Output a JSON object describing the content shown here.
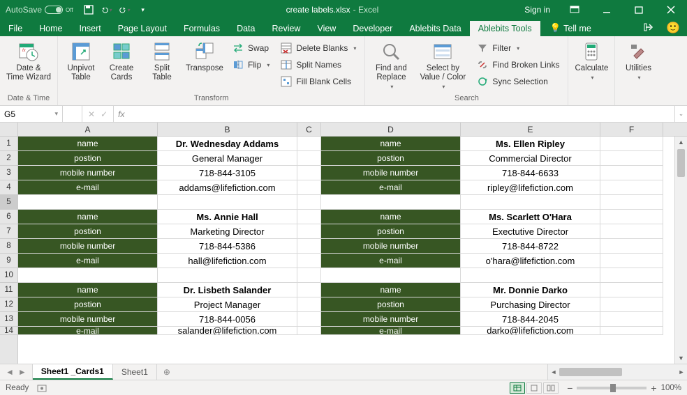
{
  "titlebar": {
    "autosave_label": "AutoSave",
    "autosave_state": "Off",
    "filename": "create labels.xlsx",
    "app_suffix": " -  Excel",
    "signin": "Sign in"
  },
  "tabs": {
    "file": "File",
    "home": "Home",
    "insert": "Insert",
    "page_layout": "Page Layout",
    "formulas": "Formulas",
    "data": "Data",
    "review": "Review",
    "view": "View",
    "developer": "Developer",
    "ablebits_data": "Ablebits Data",
    "ablebits_tools": "Ablebits Tools",
    "tell_me": "Tell me"
  },
  "ribbon": {
    "date_time": {
      "btn": "Date &\nTime Wizard",
      "group": "Date & Time"
    },
    "transform": {
      "unpivot": "Unpivot\nTable",
      "create_cards": "Create\nCards",
      "split_table": "Split\nTable",
      "transpose": "Transpose",
      "swap": "Swap",
      "flip": "Flip",
      "delete_blanks": "Delete Blanks",
      "split_names": "Split Names",
      "fill_blank": "Fill Blank Cells",
      "group": "Transform"
    },
    "search": {
      "find_replace": "Find and\nReplace",
      "select_value": "Select by\nValue / Color",
      "filter": "Filter",
      "broken_links": "Find Broken Links",
      "sync_sel": "Sync Selection",
      "group": "Search"
    },
    "calculate": {
      "btn": "Calculate",
      "group": ""
    },
    "utilities": {
      "btn": "Utilities",
      "group": ""
    }
  },
  "formula_bar": {
    "namebox": "G5",
    "formula": ""
  },
  "columns": [
    "A",
    "B",
    "C",
    "D",
    "E",
    "F"
  ],
  "row_numbers": [
    "1",
    "2",
    "3",
    "4",
    "5",
    "6",
    "7",
    "8",
    "9",
    "10",
    "11",
    "12",
    "13",
    "14"
  ],
  "labels": {
    "name": "name",
    "position": "postion",
    "mobile": "mobile number",
    "email": "e-mail"
  },
  "cards": [
    {
      "B": {
        "name": "Dr. Wednesday Addams",
        "position": "General Manager",
        "mobile": "718-844-3105",
        "email": "addams@lifefiction.com"
      },
      "E": {
        "name": "Ms. Ellen Ripley",
        "position": "Commercial Director",
        "mobile": "718-844-6633",
        "email": "ripley@lifefiction.com"
      }
    },
    {
      "B": {
        "name": "Ms. Annie Hall",
        "position": "Marketing Director",
        "mobile": "718-844-5386",
        "email": "hall@lifefiction.com"
      },
      "E": {
        "name": "Ms. Scarlett O'Hara",
        "position": "Exectutive Director",
        "mobile": "718-844-8722",
        "email": "o'hara@lifefiction.com"
      }
    },
    {
      "B": {
        "name": "Dr. Lisbeth Salander",
        "position": "Project Manager",
        "mobile": "718-844-0056",
        "email": "salander@lifefiction.com"
      },
      "E": {
        "name": "Mr. Donnie Darko",
        "position": "Purchasing Director",
        "mobile": "718-844-2045",
        "email": "darko@lifefiction.com"
      }
    }
  ],
  "sheets": {
    "active": "Sheet1 _Cards1",
    "other": "Sheet1"
  },
  "statusbar": {
    "ready": "Ready",
    "zoom": "100%"
  }
}
